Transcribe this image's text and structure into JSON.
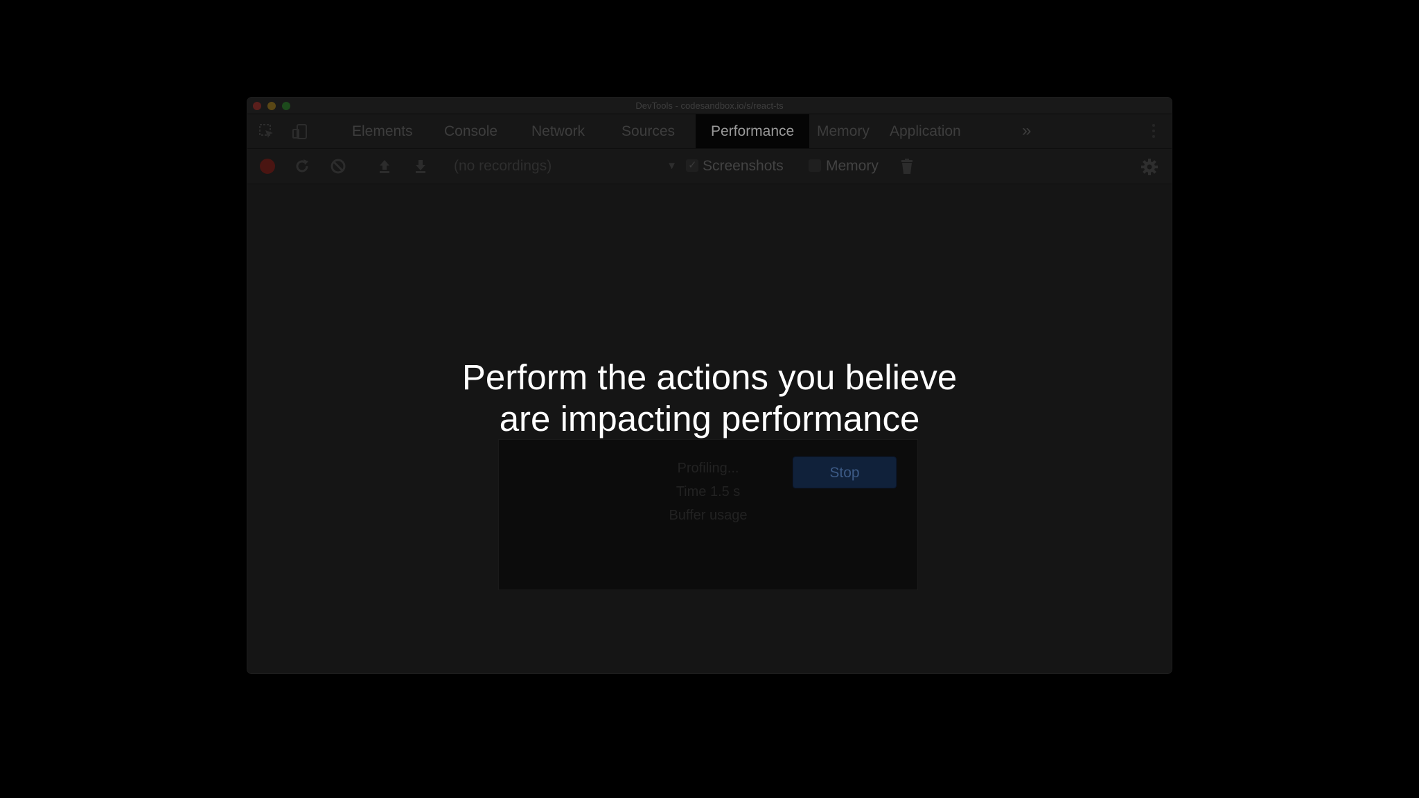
{
  "window": {
    "title": "DevTools - codesandbox.io/s/react-ts"
  },
  "toolbar_icons": {
    "inspect": "inspect-element-icon",
    "device": "device-toolbar-icon"
  },
  "tabs": [
    {
      "label": "Elements",
      "active": false
    },
    {
      "label": "Console",
      "active": false
    },
    {
      "label": "Network",
      "active": false
    },
    {
      "label": "Sources",
      "active": false
    },
    {
      "label": "Performance",
      "active": true
    },
    {
      "label": "Memory",
      "active": false
    },
    {
      "label": "Application",
      "active": false
    }
  ],
  "more_tabs_glyph": "»",
  "perf_toolbar": {
    "recordings_placeholder": "(no recordings)",
    "screenshots_label": "Screenshots",
    "screenshots_checked": true,
    "memory_label": "Memory",
    "memory_checked": false
  },
  "status_dialog": {
    "line1": "Profiling...",
    "line2": "Time  1.5 s",
    "line3": "Buffer usage",
    "stop_label": "Stop"
  },
  "overlay_caption": {
    "line1": "Perform the actions you believe",
    "line2": "are impacting performance"
  },
  "colors": {
    "background": "#000000",
    "caption": "#ffffff",
    "record": "#4a1512",
    "stop_button": "#10213a"
  }
}
